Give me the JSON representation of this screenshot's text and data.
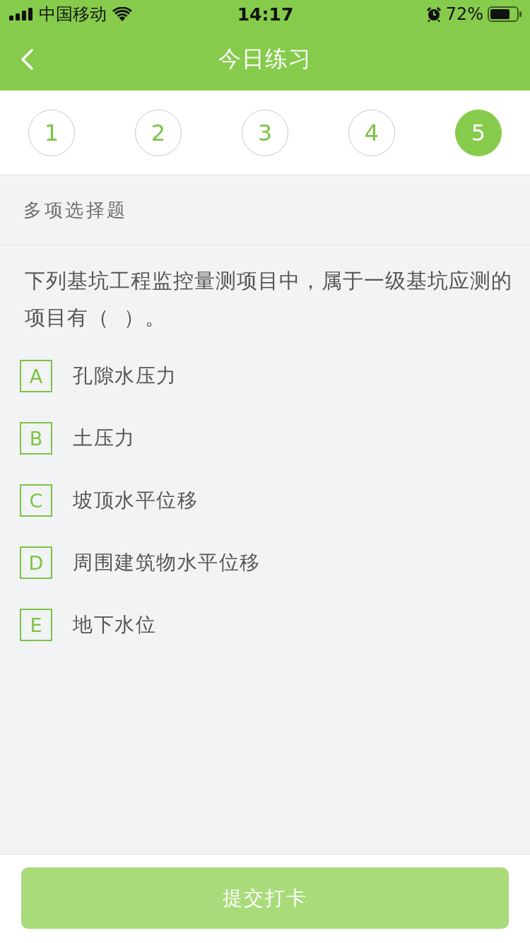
{
  "status_bar": {
    "carrier": "中国移动",
    "time": "14:17",
    "battery": "72%"
  },
  "nav_bar": {
    "title": "今日练习"
  },
  "question_nav": [
    {
      "label": "1",
      "selected": false
    },
    {
      "label": "2",
      "selected": false
    },
    {
      "label": "3",
      "selected": false
    },
    {
      "label": "4",
      "selected": false
    },
    {
      "label": "5",
      "selected": true
    }
  ],
  "section": {
    "title": "多项选择题"
  },
  "question": {
    "text": "下列基坑工程监控量测项目中，属于一级基坑应测的项目有（  ）。",
    "options": [
      {
        "letter": "A",
        "text": "孔隙水压力",
        "selected": false
      },
      {
        "letter": "B",
        "text": "土压力",
        "selected": false
      },
      {
        "letter": "C",
        "text": "坡顶水平位移",
        "selected": false
      },
      {
        "letter": "D",
        "text": "周围建筑物水平位移",
        "selected": false
      },
      {
        "letter": "E",
        "text": "地下水位",
        "selected": false
      }
    ]
  },
  "submit_button": {
    "label": "提交打卡",
    "disabled": true
  }
}
